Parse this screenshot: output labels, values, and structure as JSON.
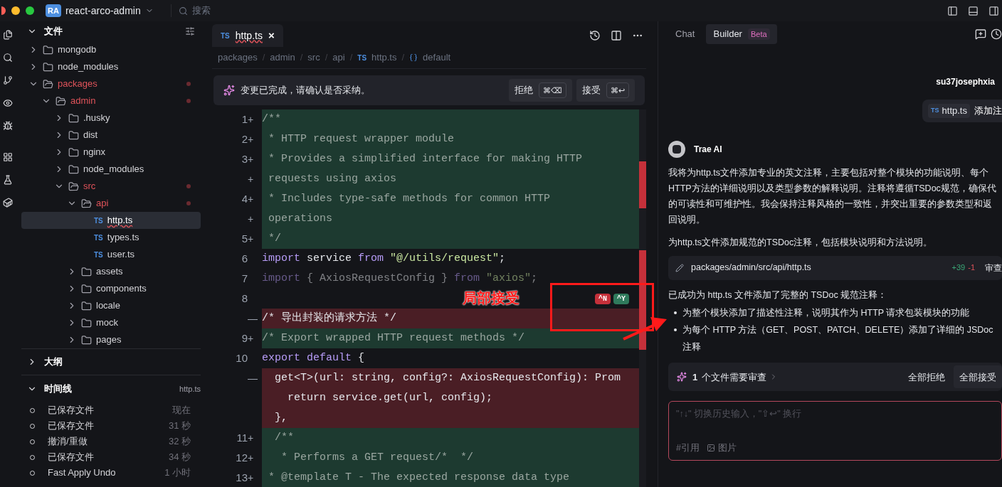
{
  "titlebar": {
    "project_badge": "RA",
    "project": "react-arco-admin",
    "search": {
      "placeholder": "搜索"
    }
  },
  "explorer": {
    "title": "文件",
    "expanded": true,
    "tree": [
      {
        "name": "mongodb",
        "kind": "folder",
        "expanded": false,
        "modified": false,
        "selected": false
      },
      {
        "name": "node_modules",
        "kind": "folder",
        "expanded": false,
        "modified": false,
        "selected": false
      },
      {
        "name": "packages",
        "kind": "folder",
        "expanded": true,
        "modified": true,
        "selected": false,
        "children": [
          {
            "name": "admin",
            "kind": "folder",
            "expanded": true,
            "modified": true,
            "selected": false,
            "children": [
              {
                "name": ".husky",
                "kind": "folder",
                "expanded": false,
                "modified": false,
                "selected": false
              },
              {
                "name": "dist",
                "kind": "folder",
                "expanded": false,
                "modified": false,
                "selected": false
              },
              {
                "name": "nginx",
                "kind": "folder",
                "expanded": false,
                "modified": false,
                "selected": false
              },
              {
                "name": "node_modules",
                "kind": "folder",
                "expanded": false,
                "modified": false,
                "selected": false
              },
              {
                "name": "src",
                "kind": "folder",
                "expanded": true,
                "modified": true,
                "selected": false,
                "children": [
                  {
                    "name": "api",
                    "kind": "folder",
                    "expanded": true,
                    "modified": true,
                    "selected": false,
                    "children": [
                      {
                        "name": "http.ts",
                        "kind": "file",
                        "badge": "TS",
                        "modified": false,
                        "selected": true
                      },
                      {
                        "name": "types.ts",
                        "kind": "file",
                        "badge": "TS",
                        "modified": false,
                        "selected": false
                      },
                      {
                        "name": "user.ts",
                        "kind": "file",
                        "badge": "TS",
                        "modified": false,
                        "selected": false
                      }
                    ]
                  },
                  {
                    "name": "assets",
                    "kind": "folder",
                    "expanded": false,
                    "modified": false,
                    "selected": false
                  },
                  {
                    "name": "components",
                    "kind": "folder",
                    "expanded": false,
                    "modified": false,
                    "selected": false
                  },
                  {
                    "name": "locale",
                    "kind": "folder",
                    "expanded": false,
                    "modified": false,
                    "selected": false
                  },
                  {
                    "name": "mock",
                    "kind": "folder",
                    "expanded": false,
                    "modified": false,
                    "selected": false
                  },
                  {
                    "name": "pages",
                    "kind": "folder",
                    "expanded": false,
                    "modified": false,
                    "selected": false
                  }
                ]
              }
            ]
          }
        ]
      }
    ]
  },
  "outline": {
    "title": "大纲",
    "expanded": false
  },
  "timeline": {
    "title": "时间线",
    "expanded": true,
    "file": "http.ts",
    "items": [
      {
        "label": "已保存文件",
        "time": "现在"
      },
      {
        "label": "已保存文件",
        "time": "31 秒"
      },
      {
        "label": "撤消/重做",
        "time": "32 秒"
      },
      {
        "label": "已保存文件",
        "time": "34 秒"
      },
      {
        "label": "Fast Apply Undo",
        "time": "1 小时"
      }
    ]
  },
  "editor": {
    "tab": {
      "badge": "TS",
      "name": "http.ts",
      "close": "×"
    },
    "breadcrumb_separator": "/",
    "breadcrumb": [
      {
        "text": "packages",
        "kind": "folder"
      },
      {
        "text": "admin",
        "kind": "folder"
      },
      {
        "text": "src",
        "kind": "folder"
      },
      {
        "text": "api",
        "kind": "folder"
      },
      {
        "text": "http.ts",
        "kind": "file",
        "badge": "TS"
      },
      {
        "text": "default",
        "kind": "symbol"
      }
    ],
    "banner": {
      "message": "变更已完成，请确认是否采纳。",
      "reject": {
        "label": "拒绝",
        "shortcut": "⌘⌫"
      },
      "accept": {
        "label": "接受",
        "shortcut": "⌘↩"
      }
    },
    "lines": [
      {
        "number": "1",
        "marker": "+",
        "kind": "added",
        "text": "/**"
      },
      {
        "number": "2",
        "marker": "+",
        "kind": "added",
        "text": " * HTTP request wrapper module"
      },
      {
        "number": "3",
        "marker": "+",
        "kind": "added",
        "text": " * Provides a simplified interface for making HTTP"
      },
      {
        "marker": "+",
        "kind": "added",
        "text": " requests using axios"
      },
      {
        "number": "4",
        "marker": "+",
        "kind": "added",
        "text": " * Includes type-safe methods for common HTTP"
      },
      {
        "marker": "+",
        "kind": "added",
        "text": " operations"
      },
      {
        "number": "5",
        "marker": "+",
        "kind": "added",
        "text": " */"
      },
      {
        "number": "6",
        "kind": "context",
        "tokens": [
          {
            "text": "import",
            "kind": "keyword"
          },
          {
            "text": " service ",
            "kind": "plain"
          },
          {
            "text": "from",
            "kind": "keyword"
          },
          {
            "text": " \"@/utils/request\"",
            "kind": "string"
          },
          {
            "text": ";",
            "kind": "plain"
          }
        ]
      },
      {
        "number": "7",
        "kind": "faded",
        "tokens": [
          {
            "text": "import",
            "kind": "keyword"
          },
          {
            "text": " { AxiosRequestConfig } ",
            "kind": "plain"
          },
          {
            "text": "from",
            "kind": "keyword"
          },
          {
            "text": " \"axios\"",
            "kind": "string"
          },
          {
            "text": ";",
            "kind": "plain"
          }
        ]
      },
      {
        "number": "8",
        "kind": "context",
        "actions": [
          {
            "label": "^N",
            "kind": "reject"
          },
          {
            "label": "^Y",
            "kind": "accept"
          }
        ]
      },
      {
        "marker": "—",
        "kind": "removed",
        "text": "/* 导出封装的请求方法 */"
      },
      {
        "number": "9",
        "marker": "+",
        "kind": "added",
        "text": "/* Export wrapped HTTP request methods */"
      },
      {
        "number": "10",
        "kind": "context",
        "tokens": [
          {
            "text": "export default",
            "kind": "keyword"
          },
          {
            "text": " {",
            "kind": "plain"
          }
        ]
      },
      {
        "marker": "—",
        "kind": "removed",
        "text": "  get<T>(url: string, config?: AxiosRequestConfig): Prom"
      },
      {
        "kind": "removed",
        "text": "    return service.get(url, config);"
      },
      {
        "kind": "removed",
        "text": "  },"
      },
      {
        "number": "11",
        "marker": "+",
        "kind": "added",
        "text": "  /**"
      },
      {
        "number": "12",
        "marker": "+",
        "kind": "added",
        "text": "   * Performs a GET request/*  */"
      },
      {
        "number": "13",
        "marker": "+",
        "kind": "added",
        "text": " * @template T - The expected response data type"
      }
    ]
  },
  "assistant": {
    "tabs": [
      {
        "label": "Chat",
        "selected": false
      },
      {
        "label": "Builder",
        "badge": "Beta",
        "selected": true
      }
    ],
    "user": {
      "name": "su37josephxia",
      "file": "http.ts",
      "file_badge": "TS",
      "message": "添加注"
    },
    "ai": {
      "name": "Trae AI",
      "paragraphs": [
        "我将为http.ts文件添加专业的英文注释，主要包括对整个模块的功能说明、每个HTTP方法的详细说明以及类型参数的解释说明。注释将遵循TSDoc规范，确保代的可读性和可维护性。我会保持注释风格的一致性，并突出重要的参数类型和返回说明。",
        "为http.ts文件添加规范的TSDoc注释，包括模块说明和方法说明。"
      ],
      "change": {
        "path": "packages/admin/src/api/http.ts",
        "added": "+39",
        "removed": "-1",
        "action": "审查"
      },
      "summary": "已成功为 http.ts 文件添加了完整的 TSDoc 规范注释：",
      "bullets": [
        "为整个模块添加了描述性注释，说明其作为 HTTP 请求包装模块的功能",
        "为每个 HTTP 方法（GET、POST、PATCH、DELETE）添加了详细的 JSDoc 注释"
      ]
    },
    "review": {
      "count": "1",
      "text": "个文件需要审查",
      "reject_all": "全部拒绝",
      "accept_all": "全部接受"
    },
    "input": {
      "placeholder": "\"↑↓\" 切换历史输入，\"⇧↩\" 换行",
      "reference": "#引用",
      "image": "图片"
    }
  },
  "annotation": {
    "label": "局部接受"
  }
}
